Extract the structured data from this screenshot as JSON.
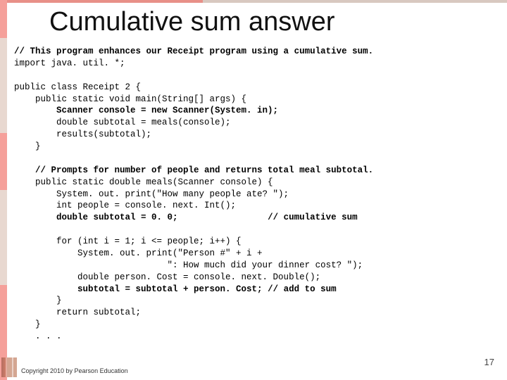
{
  "slide": {
    "title": "Cumulative sum answer",
    "code": {
      "line1a": "// This program enhances our Receipt program using a cumulative sum.",
      "line1b": "import java. util. *;",
      "blank1": "",
      "line2": "public class Receipt 2 {",
      "line3": "    public static void main(String[] args) {",
      "line4": "        Scanner console = new Scanner(System. in);",
      "line5": "        double subtotal = meals(console);",
      "line6": "        results(subtotal);",
      "line7": "    }",
      "blank2": "",
      "line8a": "    // Prompts for number of people and returns total meal subtotal.",
      "line8b": "    public static double meals(Scanner console) {",
      "line9": "        System. out. print(\"How many people ate? \");",
      "line10": "        int people = console. next. Int();",
      "line11a": "        double subtotal = 0. 0;",
      "line11b": "                 // cumulative sum",
      "blank3": "",
      "line12": "        for (int i = 1; i <= people; i++) {",
      "line13": "            System. out. print(\"Person #\" + i +",
      "line14": "                             \": How much did your dinner cost? \");",
      "line15": "            double person. Cost = console. next. Double();",
      "line16a": "            subtotal = subtotal + person. Cost;",
      "line16b": " // add to sum",
      "line17": "        }",
      "line18": "        return subtotal;",
      "line19": "    }",
      "line20": "    . . ."
    },
    "copyright": "Copyright 2010 by Pearson Education",
    "pagenum": "17"
  }
}
